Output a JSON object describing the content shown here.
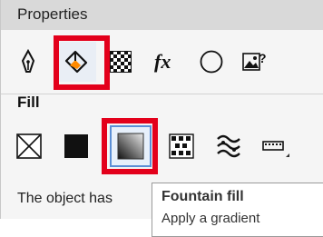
{
  "panel": {
    "title": "Properties"
  },
  "toolbar": {
    "tools": [
      {
        "name": "outline-pen-icon",
        "active": false
      },
      {
        "name": "fill-bucket-icon",
        "active": true
      },
      {
        "name": "transparency-checker-icon",
        "active": false
      },
      {
        "name": "effects-fx-icon",
        "active": false
      },
      {
        "name": "ellipse-shape-icon",
        "active": false
      },
      {
        "name": "image-question-icon",
        "active": false
      }
    ]
  },
  "fill": {
    "section_title": "Fill",
    "types": [
      {
        "name": "no-fill-icon",
        "active": false
      },
      {
        "name": "uniform-fill-icon",
        "active": false
      },
      {
        "name": "fountain-fill-icon",
        "active": true
      },
      {
        "name": "pattern-fill-icon",
        "active": false
      },
      {
        "name": "texture-fill-icon",
        "active": false
      },
      {
        "name": "postscript-fill-icon",
        "active": false
      }
    ]
  },
  "description": {
    "text": "The object has"
  },
  "tooltip": {
    "title": "Fountain fill",
    "body": "Apply a gradient"
  }
}
